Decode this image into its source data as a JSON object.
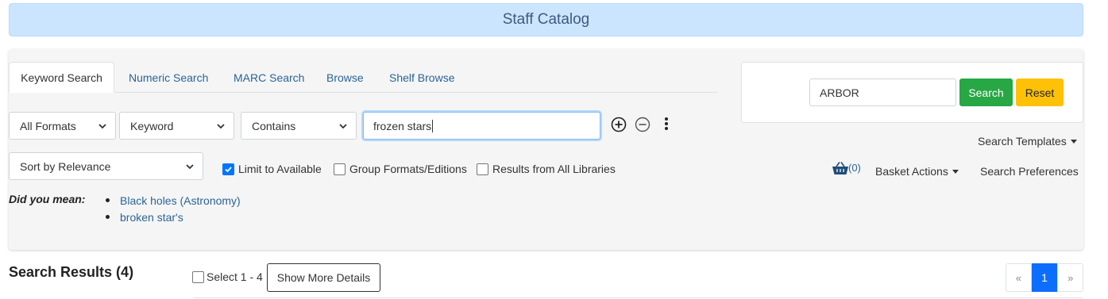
{
  "banner": {
    "title": "Staff Catalog"
  },
  "tabs": [
    {
      "label": "Keyword Search",
      "active": true
    },
    {
      "label": "Numeric Search"
    },
    {
      "label": "MARC Search"
    },
    {
      "label": "Browse"
    },
    {
      "label": "Shelf Browse"
    }
  ],
  "search_row": {
    "format": "All Formats",
    "field": "Keyword",
    "match": "Contains",
    "query": "frozen stars",
    "add_icon": "plus-circle-icon",
    "remove_icon": "minus-circle-icon",
    "more_icon": "vertical-ellipsis-icon"
  },
  "options": {
    "sort": "Sort by Relevance",
    "limit_available": {
      "label": "Limit to Available",
      "checked": true
    },
    "group_formats": {
      "label": "Group Formats/Editions",
      "checked": false
    },
    "all_libraries": {
      "label": "Results from All Libraries",
      "checked": false
    }
  },
  "did_you_mean": {
    "label": "Did you mean:",
    "suggestions": [
      "Black holes (Astronomy)",
      "broken star's"
    ]
  },
  "org_search": {
    "org_value": "ARBOR",
    "search_label": "Search",
    "reset_label": "Reset"
  },
  "search_templates_label": "Search Templates",
  "basket": {
    "count": "(0)",
    "icon": "basket-icon",
    "actions_label": "Basket Actions"
  },
  "search_preferences_label": "Search Preferences",
  "results": {
    "title": "Search Results (4)",
    "select_label": "Select 1 - 4",
    "show_more_label": "Show More Details",
    "pager": {
      "prev": "«",
      "current": "1",
      "next": "»"
    }
  },
  "colors": {
    "banner_bg": "#cce5ff",
    "link": "#2a6496",
    "search_btn": "#28a745",
    "reset_btn": "#ffc107",
    "pager_active": "#0d6efd"
  }
}
